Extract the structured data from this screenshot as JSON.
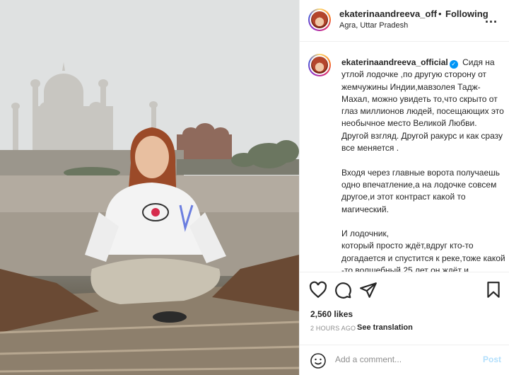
{
  "header": {
    "username": "ekaterinaandreeva_off",
    "separator": "•",
    "follow_status": "Following",
    "location": "Agra, Uttar Pradesh",
    "more": "..."
  },
  "caption": {
    "username": "ekaterinaandreeva_official",
    "verified": true,
    "text": " Сидя на утлой лодочке ,по другую сторону от жемчужины Индии,мавзолея Тадж-Махал, можно увидеть то,что скрыто от глаз миллионов людей, посещающих это необычное место Великой Любви. Другой взгляд. Другой ракурс и как сразу все меняется .\n\nВходя через главные ворота получаешь одно впечатление,а на лодочке совсем другое,и этот контраст какой то магический.\n\nИ лодочник,\nкоторый просто ждёт,вдруг кто-то догадается и спустится к реке,тоже какой -то волшебный,25 лет он ждёт и"
  },
  "actions": {
    "icons": [
      "heart-icon",
      "comment-icon",
      "share-icon",
      "bookmark-icon"
    ],
    "likes": "2,560 likes",
    "time_ago": "2 HOURS AGO",
    "see_translation": "See translation"
  },
  "comment_box": {
    "placeholder": "Add a comment...",
    "post_label": "Post"
  },
  "colors": {
    "link_blue": "#0095f6",
    "post_disabled": "#b2dffc",
    "muted": "#8e8e8e"
  }
}
